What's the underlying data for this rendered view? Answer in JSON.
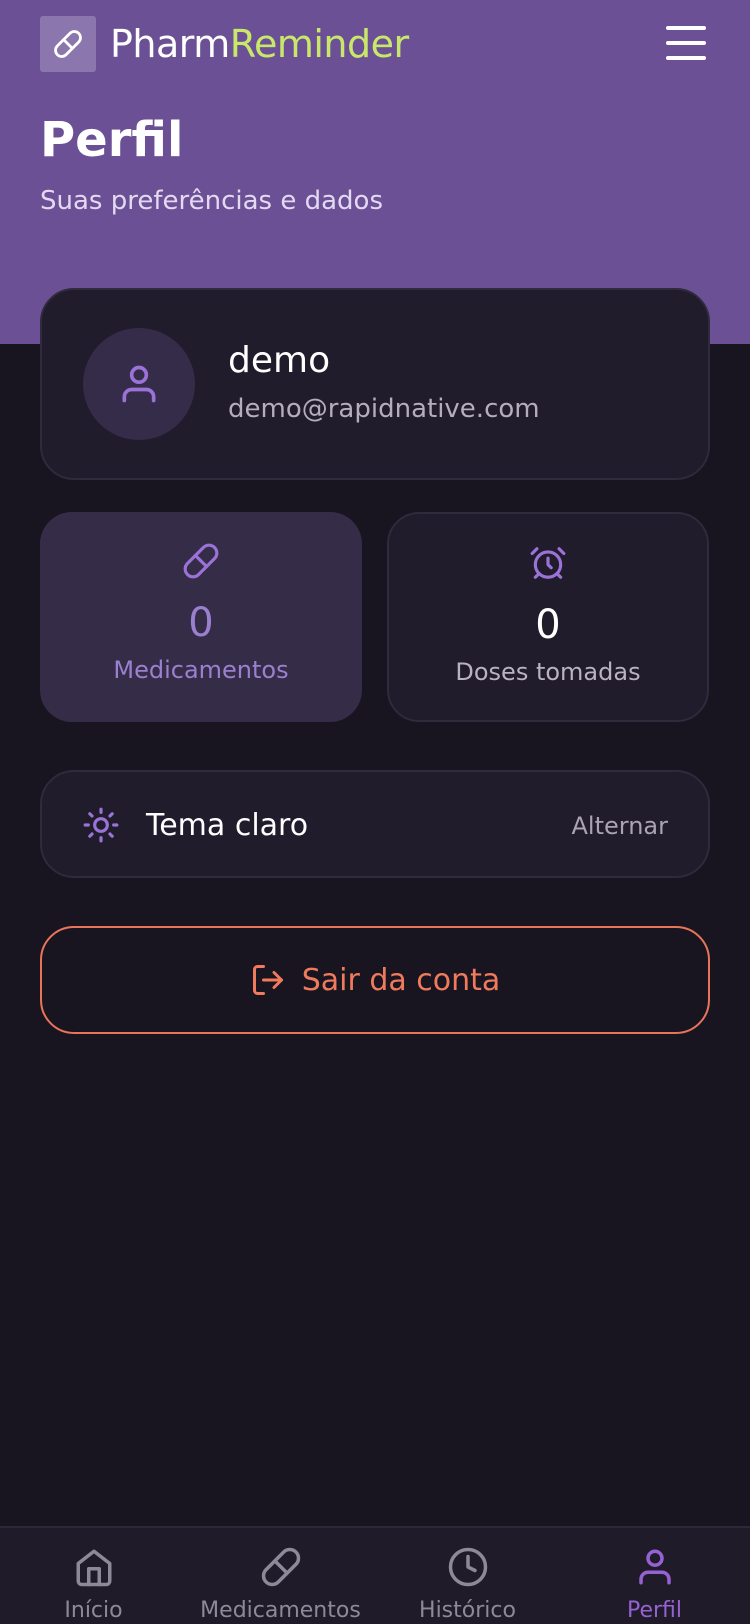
{
  "app": {
    "name_part1": "Pharm",
    "name_part2": "Reminder"
  },
  "header": {
    "title": "Perfil",
    "subtitle": "Suas preferências e dados"
  },
  "profile": {
    "name": "demo",
    "email": "demo@rapidnative.com"
  },
  "stats": [
    {
      "value": "0",
      "label": "Medicamentos",
      "icon": "pill-icon",
      "active": true
    },
    {
      "value": "0",
      "label": "Doses tomadas",
      "icon": "alarm-clock-icon",
      "active": false
    }
  ],
  "theme": {
    "label": "Tema claro",
    "action": "Alternar",
    "icon": "sun-icon"
  },
  "logout": {
    "label": "Sair da conta",
    "icon": "logout-icon"
  },
  "nav": [
    {
      "label": "Início",
      "icon": "home-icon",
      "active": false
    },
    {
      "label": "Medicamentos",
      "icon": "pill-icon",
      "active": false
    },
    {
      "label": "Histórico",
      "icon": "clock-icon",
      "active": false
    },
    {
      "label": "Perfil",
      "icon": "user-icon",
      "active": true
    }
  ],
  "colors": {
    "header_bg": "#6b5096",
    "brand_accent": "#c9e86a",
    "background": "#181520",
    "card": "#201c2b",
    "primary": "#9561d3",
    "danger": "#ef7a5c"
  }
}
